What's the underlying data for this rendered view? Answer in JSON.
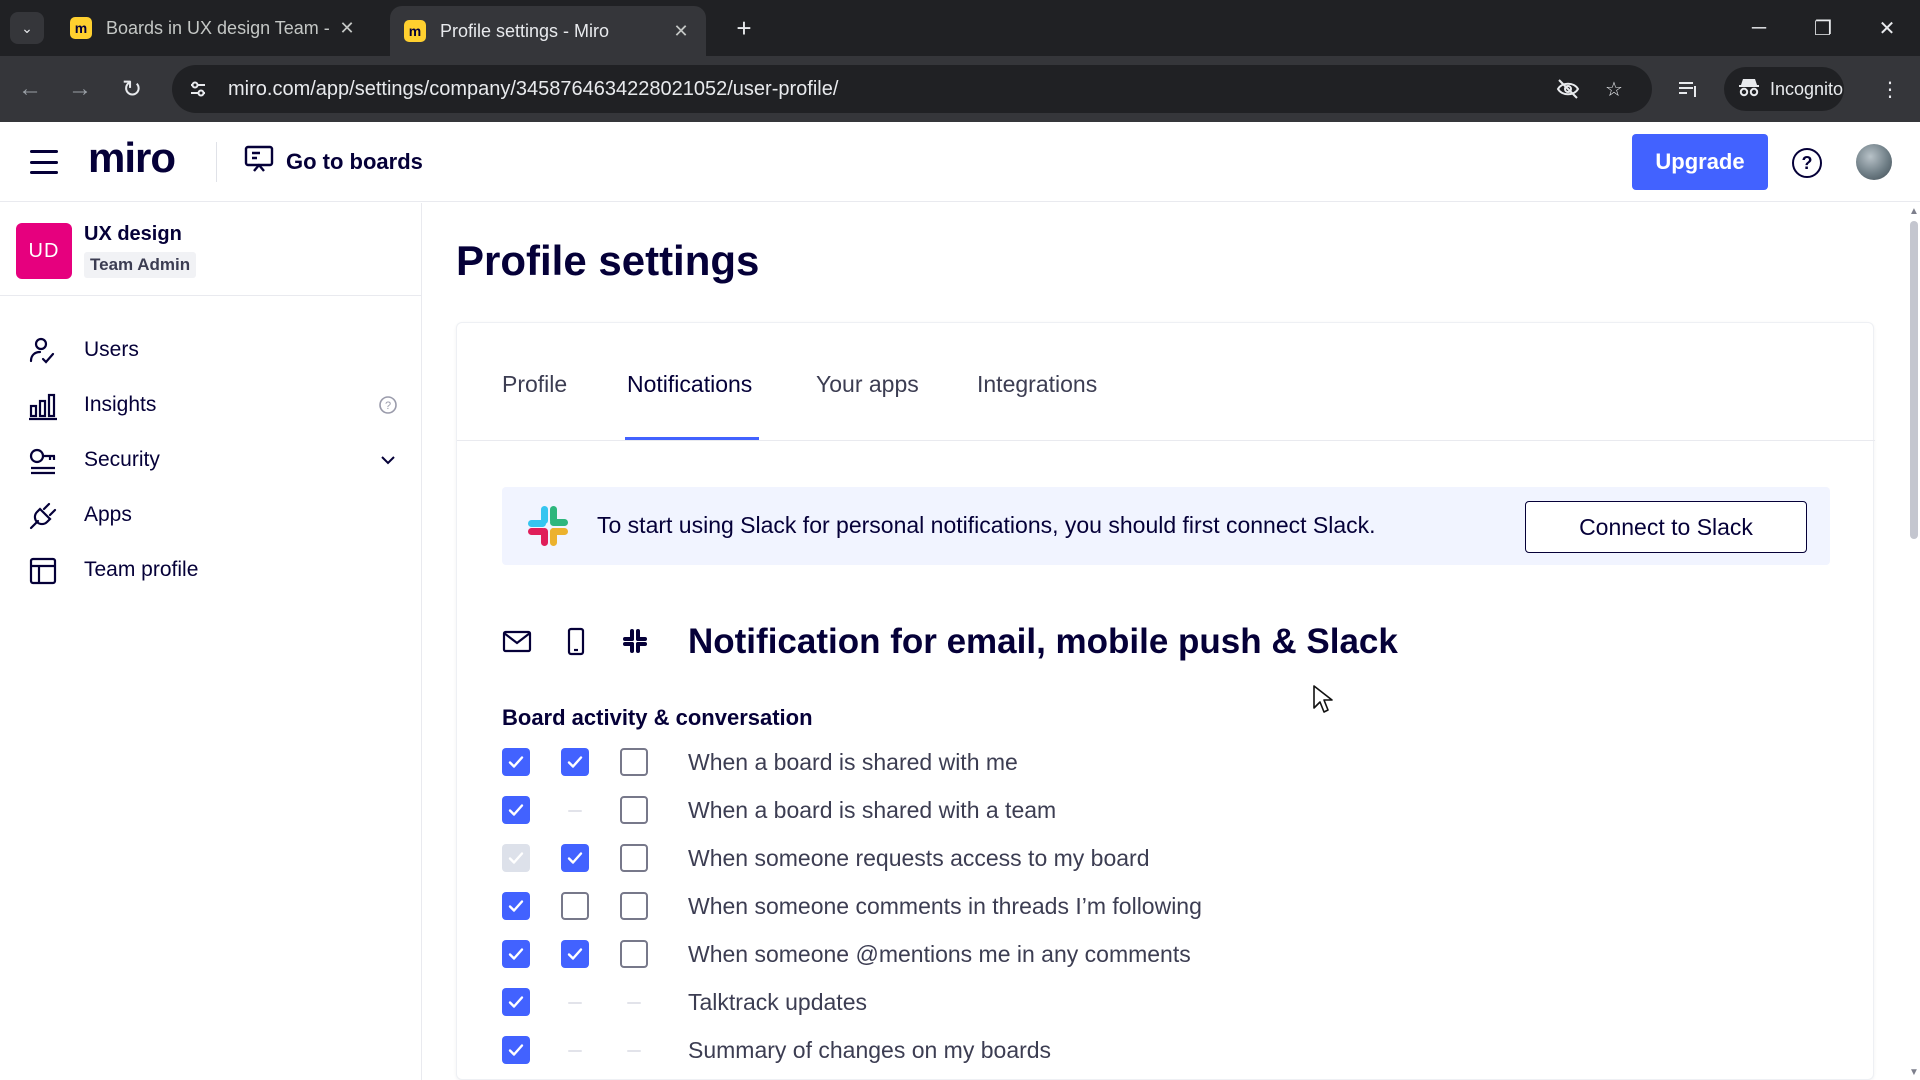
{
  "browser": {
    "tabs": [
      {
        "title": "Boards in UX design Team - Miro",
        "active": false
      },
      {
        "title": "Profile settings - Miro",
        "active": true
      }
    ],
    "url": "miro.com/app/settings/company/3458764634228021052/user-profile/",
    "incognito_label": "Incognito"
  },
  "header": {
    "logo": "miro",
    "go_to_boards": "Go to boards",
    "upgrade": "Upgrade",
    "help_symbol": "?"
  },
  "sidebar": {
    "team": {
      "initials": "UD",
      "name": "UX design",
      "role": "Team Admin",
      "color": "#e6007e"
    },
    "items": [
      {
        "label": "Users",
        "icon": "user-check-icon"
      },
      {
        "label": "Insights",
        "icon": "bar-chart-icon"
      },
      {
        "label": "Security",
        "icon": "key-icon"
      },
      {
        "label": "Apps",
        "icon": "plug-icon"
      },
      {
        "label": "Team profile",
        "icon": "layout-icon"
      }
    ]
  },
  "main": {
    "title": "Profile settings",
    "tabs": [
      "Profile",
      "Notifications",
      "Your apps",
      "Integrations"
    ],
    "active_tab": "Notifications",
    "slack_banner": {
      "text": "To start using Slack for personal notifications, you should first connect Slack.",
      "button": "Connect to Slack"
    },
    "notifications_title": "Notification for email, mobile push & Slack",
    "channels": [
      "email-icon",
      "mobile-icon",
      "slack-icon"
    ],
    "section_title": "Board activity & conversation",
    "rows": [
      {
        "label": "When a board is shared with me",
        "email": "on",
        "mobile": "on",
        "slack": "off"
      },
      {
        "label": "When a board is shared with a team",
        "email": "on",
        "mobile": "none",
        "slack": "off"
      },
      {
        "label": "When someone requests access to my board",
        "email": "disabled",
        "mobile": "on",
        "slack": "off"
      },
      {
        "label": "When someone comments in threads I’m following",
        "email": "on",
        "mobile": "off",
        "slack": "off"
      },
      {
        "label": "When someone @mentions me in any comments",
        "email": "on",
        "mobile": "on",
        "slack": "off"
      },
      {
        "label": "Talktrack updates",
        "email": "on",
        "mobile": "none",
        "slack": "none"
      },
      {
        "label": "Summary of changes on my boards",
        "email": "on",
        "mobile": "none",
        "slack": "none"
      }
    ]
  },
  "colors": {
    "accent": "#4262ff",
    "text": "#050038",
    "banner": "#f1f4ff"
  }
}
